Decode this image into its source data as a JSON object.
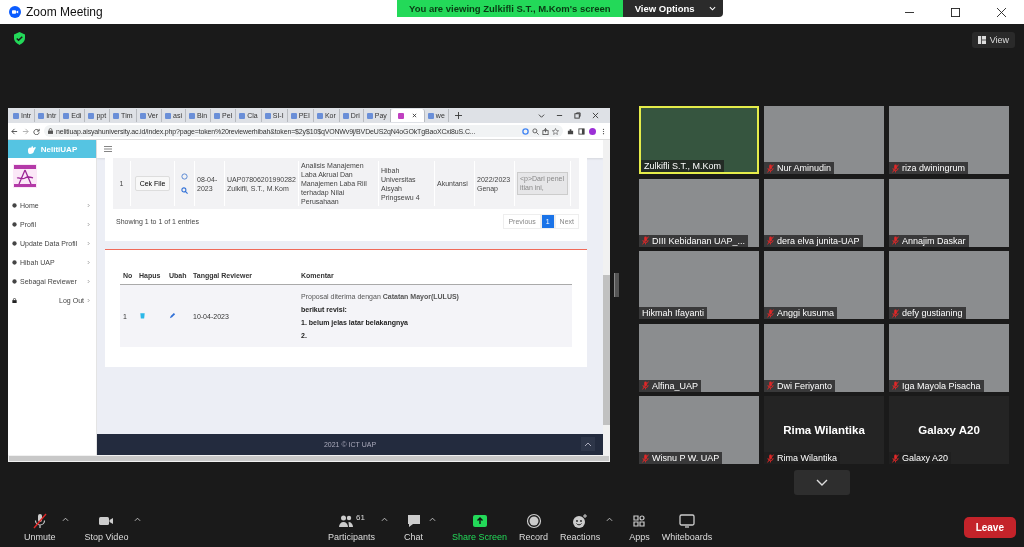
{
  "window": {
    "title": "Zoom Meeting"
  },
  "banner": {
    "text": "You are viewing Zulkifli S.T., M.Kom's screen",
    "button": "View Options"
  },
  "view_button": "View",
  "shared_screen": {
    "browser": {
      "tabs": [
        {
          "label": "Intr",
          "selected": false
        },
        {
          "label": "Intr",
          "selected": false
        },
        {
          "label": "Edi",
          "selected": false
        },
        {
          "label": "ppt",
          "selected": false
        },
        {
          "label": "Tim",
          "selected": false
        },
        {
          "label": "Ver",
          "selected": false
        },
        {
          "label": "asi",
          "selected": false
        },
        {
          "label": "Bin",
          "selected": false
        },
        {
          "label": "Pel",
          "selected": false
        },
        {
          "label": "Cla",
          "selected": false
        },
        {
          "label": "SI-I",
          "selected": false
        },
        {
          "label": "PEI",
          "selected": false
        },
        {
          "label": "Kor",
          "selected": false
        },
        {
          "label": "Dri",
          "selected": false
        },
        {
          "label": "Pay",
          "selected": false
        },
        {
          "selected": true
        },
        {
          "label": "we",
          "selected": false
        }
      ],
      "address": "nelitiuap.aisyahuniversity.ac.id/index.php?page=token%20reviewerhibah&token=$2y$10$qVONWv9j/BVDeUS2qN4oGOkTgBaoXCxi8uS.C...",
      "app": {
        "brand": "NelitiUAP",
        "menu": [
          {
            "label": "Home"
          },
          {
            "label": "Profil"
          },
          {
            "label": "Update Data Profil"
          },
          {
            "label": "Hibah UAP"
          },
          {
            "label": "Sebagai Reviewer"
          }
        ],
        "logout": "Log Out",
        "proposal_row": {
          "no": "1",
          "button": "Cek File",
          "date": "08-04-2023",
          "code": "UAP07806201990282",
          "researcher": "Zulkifli, S.T., M.Kom",
          "title": "Analisis Manajemen Laba Akrual Dan Manajemen Laba Riil terhadap Nilai Perusahaan",
          "scheme": "Hibah Universitas Aisyah Pringsewu 4",
          "field": "Akuntansi",
          "period": "2022/2023 Genap",
          "summary": "<p>Dari penelitian ini,"
        },
        "entries": "Showing 1 to 1 of 1 entries",
        "pagination": [
          {
            "label": "Previous",
            "selected": false
          },
          {
            "label": "1",
            "selected": true
          },
          {
            "label": "Next",
            "selected": false
          }
        ],
        "review_table": {
          "columns": [
            "No",
            "Hapus",
            "Ubah",
            "Tanggal Reviewer",
            "Komentar"
          ],
          "rows": [
            {
              "no": "1",
              "date": "10-04-2023",
              "comment": [
                {
                  "text": "Proposal diterima dengan **Catatan Mayor(LULUS)**",
                  "bold": false
                },
                {
                  "text": "berikut revisi:",
                  "bold": true
                },
                {
                  "text": "1. belum jelas latar belakangnya",
                  "bold": true
                },
                {
                  "text": "2.",
                  "bold": true
                }
              ]
            }
          ]
        },
        "footer": "2021 © ICT UAP"
      }
    }
  },
  "participants": [
    {
      "name": "Zulkifli S.T., M.Kom",
      "kind": "video",
      "muted": false,
      "active_speaker": true
    },
    {
      "name": "Nur Aminudin",
      "kind": "video",
      "muted": true,
      "active_speaker": false
    },
    {
      "name": "riza dwiningrum",
      "kind": "video",
      "muted": true,
      "active_speaker": false
    },
    {
      "name": "DIII Kebidanan UAP_...",
      "kind": "video",
      "muted": true,
      "active_speaker": false
    },
    {
      "name": "dera elva junita-UAP",
      "kind": "video",
      "muted": true,
      "active_speaker": false
    },
    {
      "name": "Annajim Daskar",
      "kind": "video",
      "muted": true,
      "active_speaker": false
    },
    {
      "name": "Hikmah Ifayanti",
      "kind": "video",
      "muted": false,
      "active_speaker": false
    },
    {
      "name": "Anggi kusuma",
      "kind": "video",
      "muted": true,
      "active_speaker": false
    },
    {
      "name": "defy gustianing",
      "kind": "video",
      "muted": true,
      "active_speaker": false
    },
    {
      "name": "Alfina_UAP",
      "kind": "video",
      "muted": true,
      "active_speaker": false
    },
    {
      "name": "Dwi Feriyanto",
      "kind": "video",
      "muted": true,
      "active_speaker": false
    },
    {
      "name": "Iga Mayola Pisacha",
      "kind": "video",
      "muted": true,
      "active_speaker": false
    },
    {
      "name": "Wisnu P W. UAP",
      "kind": "video",
      "muted": true,
      "active_speaker": false
    },
    {
      "name": "Rima Wilantika",
      "kind": "name-only",
      "display_name": "Rima Wilantika",
      "muted": true,
      "active_speaker": false
    },
    {
      "name": "Galaxy A20",
      "kind": "name-only",
      "display_name": "Galaxy A20",
      "muted": true,
      "active_speaker": false
    }
  ],
  "toolbar": {
    "items": [
      {
        "kind": "audio",
        "label": "Unmute",
        "caret": true
      },
      {
        "kind": "video",
        "label": "Stop Video",
        "caret": true
      },
      {
        "kind": "participants",
        "label": "Participants",
        "count": "61",
        "caret": true
      },
      {
        "kind": "chat",
        "label": "Chat",
        "caret": true
      },
      {
        "kind": "share",
        "label": "Share Screen",
        "caret": false
      },
      {
        "kind": "record",
        "label": "Record",
        "caret": false
      },
      {
        "kind": "reactions",
        "label": "Reactions",
        "caret": true
      },
      {
        "kind": "apps",
        "label": "Apps",
        "caret": false
      },
      {
        "kind": "whiteboards",
        "label": "Whiteboards",
        "caret": false
      }
    ],
    "leave": "Leave"
  }
}
